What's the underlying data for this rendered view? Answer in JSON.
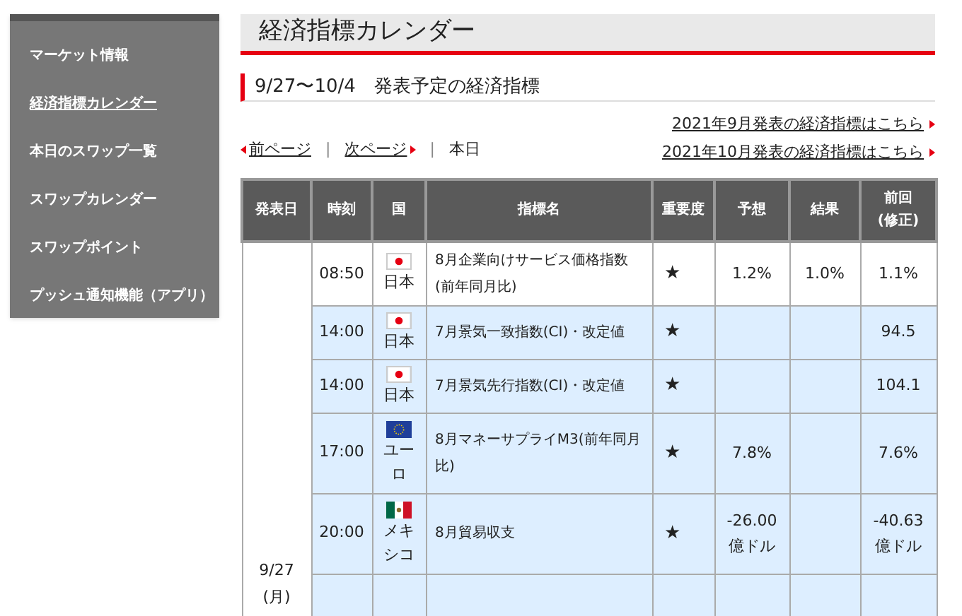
{
  "sidebar": {
    "items": [
      {
        "label": "マーケット情報",
        "selected": false
      },
      {
        "label": "経済指標カレンダー",
        "selected": true
      },
      {
        "label": "本日のスワップ一覧",
        "selected": false
      },
      {
        "label": "スワップカレンダー",
        "selected": false
      },
      {
        "label": "スワップポイント",
        "selected": false
      },
      {
        "label": "プッシュ通知機能（アプリ）",
        "selected": false
      }
    ]
  },
  "page_title": "経済指標カレンダー",
  "section_title": "9/27〜10/4　発表予定の経済指標",
  "month_links": [
    "2021年9月発表の経済指標はこちら",
    "2021年10月発表の経済指標はこちら"
  ],
  "pager": {
    "prev": "前ページ",
    "separator_1": "|",
    "next": "次ページ",
    "separator_2": "|",
    "today": "本日"
  },
  "table": {
    "columns": [
      "発表日",
      "時刻",
      "国",
      "指標名",
      "重要度",
      "予想",
      "結果",
      "前回\n(修正)"
    ],
    "date": "9/27\n(月)",
    "rows": [
      {
        "time": "08:50",
        "kind": "jp",
        "country": "日本",
        "name": "8月企業向けサービス価格指数(前年同月比)",
        "importance": "★",
        "forecast": "1.2%",
        "result": "1.0%",
        "previous": "1.1%",
        "highlighted": false
      },
      {
        "time": "14:00",
        "kind": "jp",
        "country": "日本",
        "name": "7月景気一致指数(CI)・改定値",
        "importance": "★",
        "previous": "94.5",
        "highlighted": true
      },
      {
        "time": "14:00",
        "kind": "jp",
        "country": "日本",
        "name": "7月景気先行指数(CI)・改定値",
        "importance": "★",
        "previous": "104.1",
        "highlighted": true
      },
      {
        "time": "17:00",
        "kind": "eu",
        "country": "ユーロ",
        "name": "8月マネーサプライM3(前年同月比)",
        "importance": "★",
        "forecast": "7.8%",
        "previous": "7.6%",
        "highlighted": true
      },
      {
        "time": "20:00",
        "kind": "mx",
        "country": "メキシコ",
        "name": "8月貿易収支",
        "importance": "★",
        "forecast": "-26.00億ドル",
        "previous": "-40.63億ドル",
        "highlighted": true
      }
    ]
  }
}
